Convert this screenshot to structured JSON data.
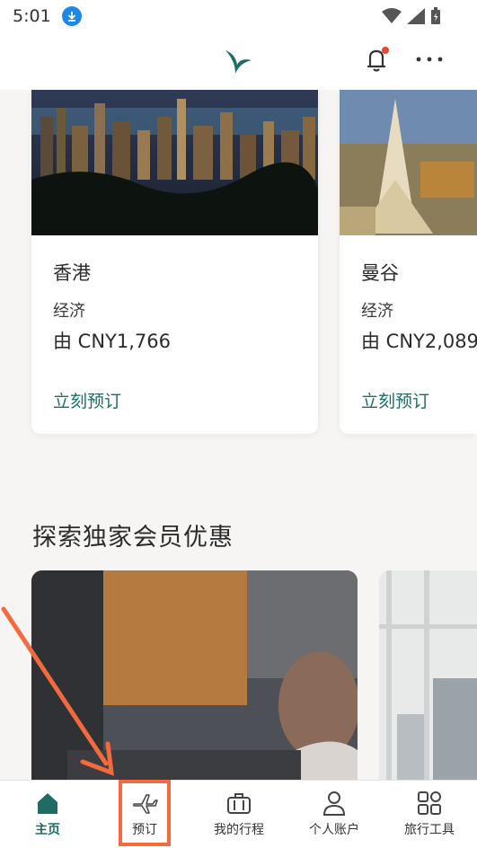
{
  "status_bar": {
    "time": "5:01"
  },
  "header": {
    "logo": "cathay-logo",
    "notification_icon": "bell-icon",
    "menu_icon": "more-icon"
  },
  "destinations": [
    {
      "city": "香港",
      "cabin": "经济",
      "price": "由 CNY1,766",
      "cta": "立刻预订"
    },
    {
      "city": "曼谷",
      "cabin": "经济",
      "price": "由 CNY2,089",
      "cta": "立刻预订"
    }
  ],
  "section": {
    "title": "探索独家会员优惠"
  },
  "bottom_nav": [
    {
      "label": "主页",
      "icon": "home-icon",
      "active": true
    },
    {
      "label": "预订",
      "icon": "airplane-icon",
      "active": false
    },
    {
      "label": "我的行程",
      "icon": "suitcase-icon",
      "active": false
    },
    {
      "label": "个人账户",
      "icon": "person-icon",
      "active": false
    },
    {
      "label": "旅行工具",
      "icon": "grid-icon",
      "active": false
    }
  ],
  "colors": {
    "accent": "#1f6c65",
    "highlight": "#f26a3d",
    "notification_dot": "#e8472b"
  }
}
